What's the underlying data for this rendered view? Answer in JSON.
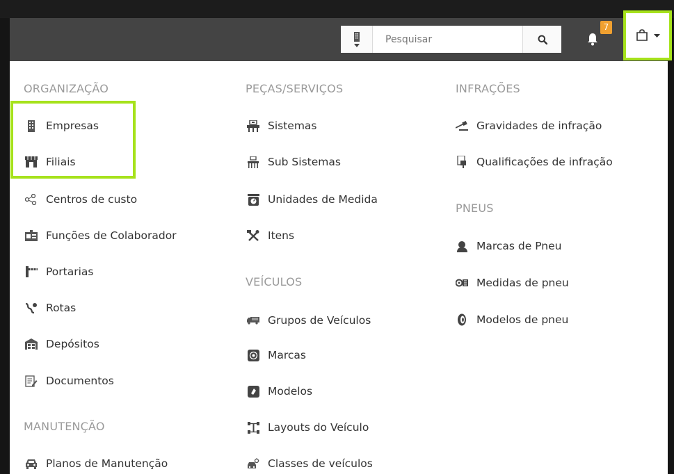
{
  "header": {
    "search_placeholder": "Pesquisar",
    "notification_count": "7"
  },
  "colors": {
    "accent_highlight": "#a6e21c",
    "topbar": "#444444",
    "badge": "#f0a030"
  },
  "menu": {
    "organizacao": {
      "title": "ORGANIZAÇÃO",
      "items": [
        {
          "label": "Empresas",
          "icon": "building-icon"
        },
        {
          "label": "Filiais",
          "icon": "store-icon"
        },
        {
          "label": "Centros de custo",
          "icon": "network-icon"
        },
        {
          "label": "Funções de Colaborador",
          "icon": "id-badge-icon"
        },
        {
          "label": "Portarias",
          "icon": "gate-icon"
        },
        {
          "label": "Rotas",
          "icon": "route-icon"
        },
        {
          "label": "Depósitos",
          "icon": "warehouse-icon"
        },
        {
          "label": "Documentos",
          "icon": "document-edit-icon"
        }
      ]
    },
    "manutencao": {
      "title": "MANUTENÇÃO",
      "items": [
        {
          "label": "Planos de Manutenção",
          "icon": "car-maintenance-icon"
        }
      ]
    },
    "pecas": {
      "title": "PEÇAS/SERVIÇOS",
      "items": [
        {
          "label": "Sistemas",
          "icon": "system-icon"
        },
        {
          "label": "Sub Sistemas",
          "icon": "subsystem-icon"
        },
        {
          "label": "Unidades de Medida",
          "icon": "scale-icon"
        },
        {
          "label": "Itens",
          "icon": "tools-icon"
        }
      ]
    },
    "veiculos": {
      "title": "VEÍCULOS",
      "items": [
        {
          "label": "Grupos de Veículos",
          "icon": "truck-icon"
        },
        {
          "label": "Marcas",
          "icon": "brand-badge-icon"
        },
        {
          "label": "Modelos",
          "icon": "model-shield-icon"
        },
        {
          "label": "Layouts do Veículo",
          "icon": "axle-layout-icon"
        },
        {
          "label": "Classes de veículos",
          "icon": "vehicle-class-icon"
        }
      ]
    },
    "infracoes": {
      "title": "INFRAÇÕES",
      "items": [
        {
          "label": "Gravidades de infração",
          "icon": "gavel-icon"
        },
        {
          "label": "Qualificações de infração",
          "icon": "qualification-icon"
        }
      ]
    },
    "pneus": {
      "title": "PNEUS",
      "items": [
        {
          "label": "Marcas de Pneu",
          "icon": "tire-brand-icon"
        },
        {
          "label": "Medidas de pneu",
          "icon": "tire-measure-icon"
        },
        {
          "label": "Modelos de pneu",
          "icon": "tire-icon"
        }
      ]
    }
  }
}
